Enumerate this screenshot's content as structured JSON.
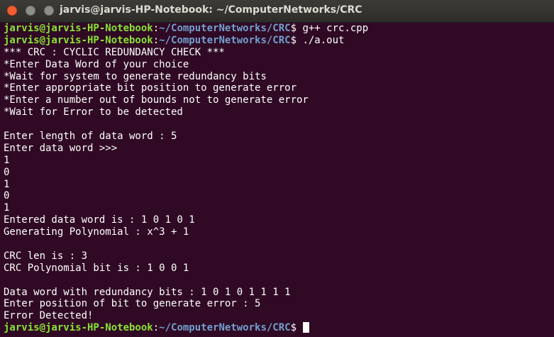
{
  "window": {
    "title": "jarvis@jarvis-HP-Notebook: ~/ComputerNetworks/CRC"
  },
  "prompt": {
    "user_host": "jarvis@jarvis-HP-Notebook",
    "colon": ":",
    "path": "~/ComputerNetworks/CRC",
    "dollar": "$ "
  },
  "commands": [
    "g++ crc.cpp",
    "./a.out"
  ],
  "output": [
    "*** CRC : CYCLIC REDUNDANCY CHECK ***",
    "*Enter Data Word of your choice",
    "*Wait for system to generate redundancy bits",
    "*Enter appropriate bit position to generate error",
    "*Enter a number out of bounds not to generate error",
    "*Wait for Error to be detected",
    "",
    "Enter length of data word : 5",
    "Enter data word >>>",
    "1",
    "0",
    "1",
    "0",
    "1",
    "Entered data word is : 1 0 1 0 1",
    "Generating Polynomial : x^3 + 1",
    "",
    "CRC len is : 3",
    "CRC Polynomial bit is : 1 0 0 1",
    "",
    "Data word with redundancy bits : 1 0 1 0 1 1 1 1",
    "Enter position of bit to generate error : 5",
    "Error Detected!"
  ],
  "colors": {
    "background": "#300a24",
    "user_host": "#8ae234",
    "path": "#729fcf",
    "text": "#ffffff",
    "close_button": "#f15e31"
  }
}
